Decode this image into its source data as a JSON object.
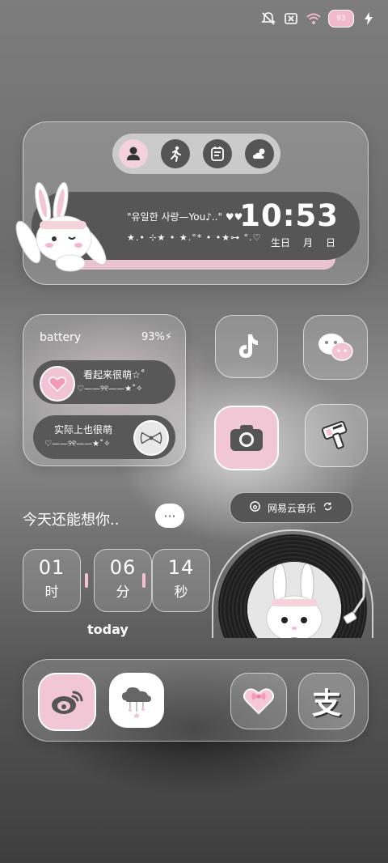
{
  "status_bar": {
    "icons": [
      "mute-icon",
      "no-sim-icon",
      "wifi-icon",
      "battery-icon",
      "charging-icon"
    ],
    "battery_text": "93"
  },
  "top_widget": {
    "tabs": [
      "profile-icon",
      "running-icon",
      "calendar-icon",
      "weather-icon"
    ],
    "song_text": "\"유일한 사랑—You♪..\" ♥♥",
    "stars_text": "★.• ⊹★ • ★.°* • •★⊶ °.♡",
    "time": "10:53",
    "date_labels": [
      "生日",
      "月",
      "日"
    ]
  },
  "battery_widget": {
    "label": "battery",
    "percent": "93%",
    "row1_title": "看起来很萌☆˚",
    "row1_deco": "♡——୨୧——★˚✧",
    "row2_title": "实际上也很萌",
    "row2_deco": "♡——୨୧——★˚✧"
  },
  "apps": {
    "tiktok": "tiktok-icon",
    "wechat": "wechat-icon",
    "camera": "camera-icon",
    "tool": "tool-icon",
    "weibo": "weibo-icon",
    "cloud": "cloud-icon",
    "heart": "heart-icon",
    "alipay": "alipay-icon",
    "alipay_glyph": "支"
  },
  "music": {
    "app_name": "网易云音乐"
  },
  "miss_you": {
    "text": "今天还能想你..",
    "bubble": "···"
  },
  "timer": {
    "hours": "01",
    "hours_unit": "时",
    "minutes": "06",
    "minutes_unit": "分",
    "seconds": "14",
    "seconds_unit": "秒",
    "caption": "today"
  },
  "colors": {
    "accent_pink": "#f1c6d5",
    "dark_pill": "#565656"
  }
}
